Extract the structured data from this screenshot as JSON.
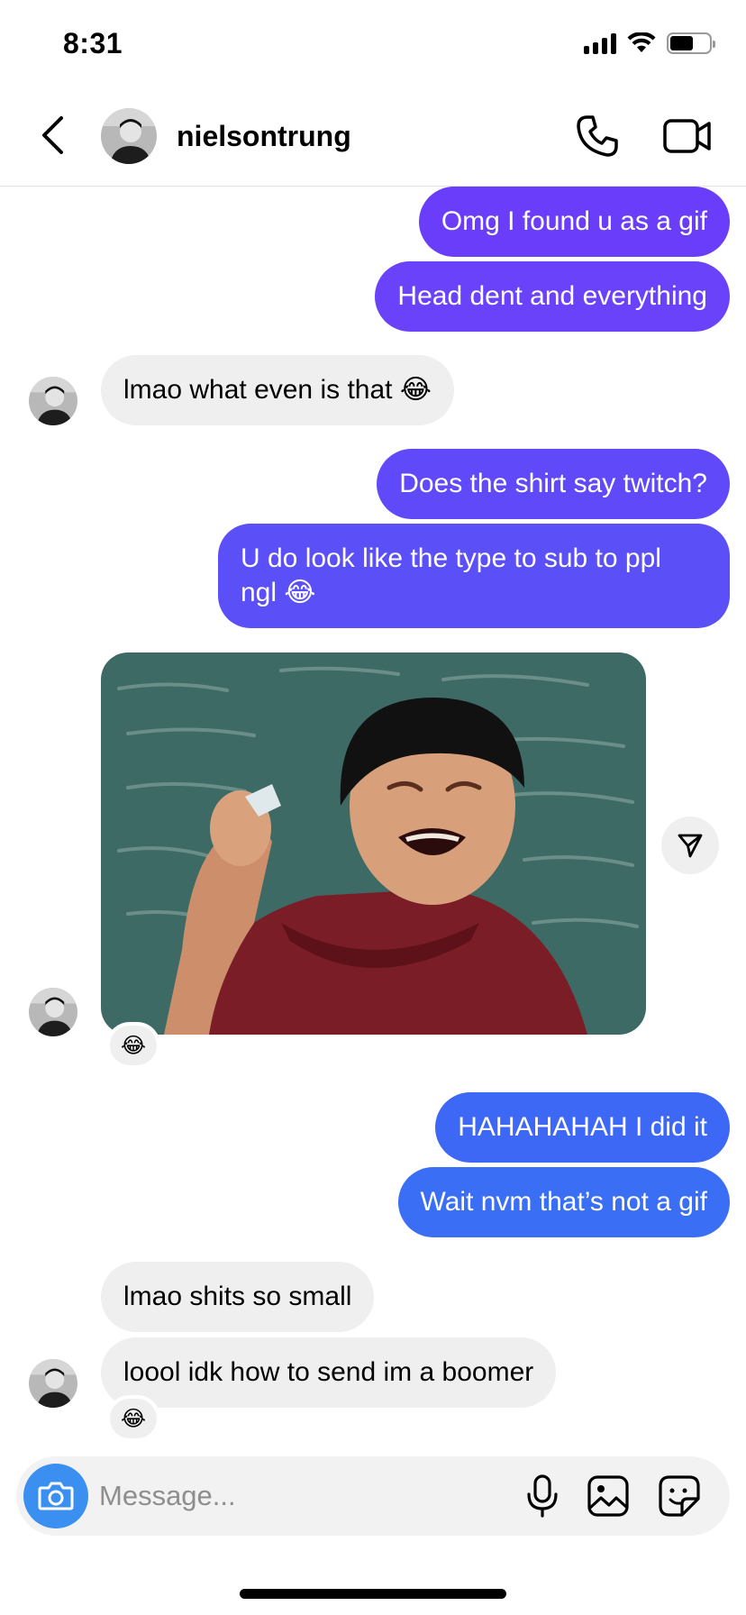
{
  "status_bar": {
    "time": "8:31"
  },
  "header": {
    "username": "nielsontrung"
  },
  "messages": [
    {
      "text": "Omg I found u as a gif",
      "direction": "out",
      "color": "#6a3dfa"
    },
    {
      "text": "Head dent and everything",
      "direction": "out",
      "color": "#6a42f9"
    },
    {
      "text": "lmao what even is that 😂",
      "direction": "in"
    },
    {
      "text": "Does the shirt say twitch?",
      "direction": "out",
      "color": "#5f49f9"
    },
    {
      "text_line1": "U do look like the type to sub to ppl",
      "text_line2": "ngl 😂",
      "direction": "out",
      "color": "#5b4ff8"
    },
    {
      "type": "gif",
      "direction": "in",
      "reaction": "😂"
    },
    {
      "text": "HAHAHAHAH I did it",
      "direction": "out",
      "color": "#3d68f5"
    },
    {
      "text": "Wait nvm that’s not a gif",
      "direction": "out",
      "color": "#3a6ef5"
    },
    {
      "text": "lmao shits so small",
      "direction": "in"
    },
    {
      "text": "loool idk how to send im a boomer",
      "direction": "in",
      "reaction": "😂"
    }
  ],
  "composer": {
    "placeholder": "Message..."
  },
  "icons": {
    "back": "chevron-left-icon",
    "call": "phone-icon",
    "video": "video-camera-icon",
    "share": "send-icon",
    "camera": "camera-icon",
    "mic": "microphone-icon",
    "gallery": "image-icon",
    "sticker": "sticker-icon"
  },
  "colors": {
    "accent_camera": "#3a8ff0",
    "incoming_bubble": "#efefef"
  }
}
